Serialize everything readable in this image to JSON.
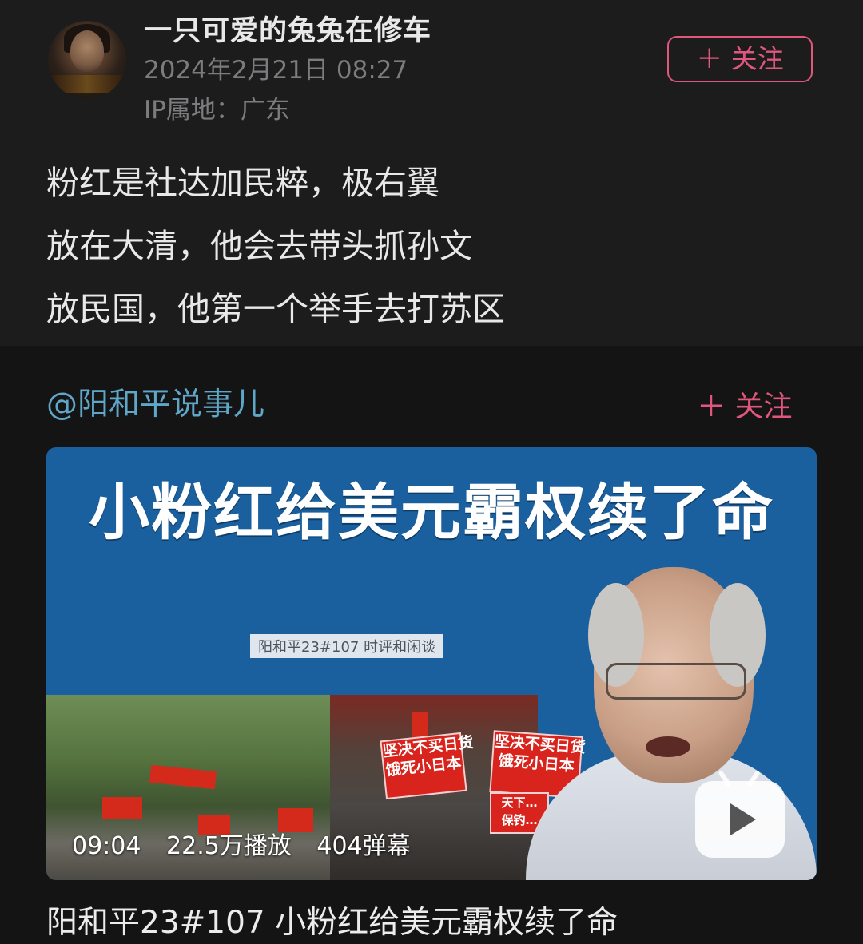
{
  "post": {
    "username": "一只可爱的兔兔在修车",
    "timestamp": "2024年2月21日 08:27",
    "ip_location": "IP属地：广东",
    "follow_label": "＋ 关注",
    "text_lines": [
      "粉红是社达加民粹，极右翼",
      "放在大清，他会去带头抓孙文",
      "放民国，他第一个举手去打苏区"
    ]
  },
  "shared": {
    "author": "@阳和平说事儿",
    "follow_label": "＋ 关注"
  },
  "video": {
    "title_overlay": "小粉红给美元霸权续了命",
    "subtitle_overlay": "阳和平23#107 时评和闲谈",
    "signs": [
      "坚决不买日货",
      "饿死小日本",
      "坚决不买日货",
      "饿死小日本",
      "天下…",
      "保钓…"
    ],
    "duration": "09:04",
    "plays": "22.5万播放",
    "danmaku": "404弹幕",
    "caption": "阳和平23#107 小粉红给美元霸权续了命"
  }
}
